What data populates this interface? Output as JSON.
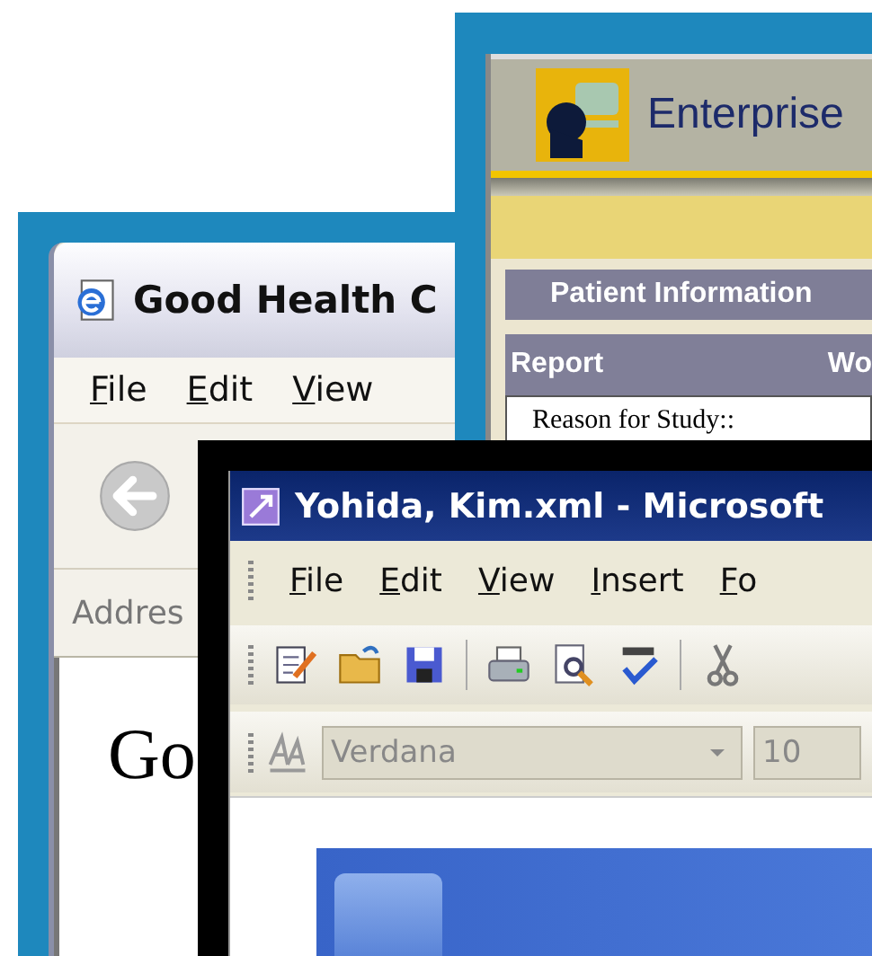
{
  "windows": [
    {
      "kind": "browser",
      "title": "Good Health C",
      "menu": [
        "File",
        "Edit",
        "View"
      ],
      "address_label": "Addres",
      "heading": "Go"
    },
    {
      "kind": "portal",
      "app_title": "Enterprise",
      "section": "Patient Information",
      "columns": [
        "Report",
        "Wo"
      ],
      "field_label": "Reason for Study::"
    },
    {
      "kind": "editor",
      "title": "Yohida, Kim.xml - Microsoft",
      "menu": [
        "File",
        "Edit",
        "View",
        "Insert",
        "Fo"
      ],
      "font": "Verdana",
      "size": "10"
    }
  ]
}
